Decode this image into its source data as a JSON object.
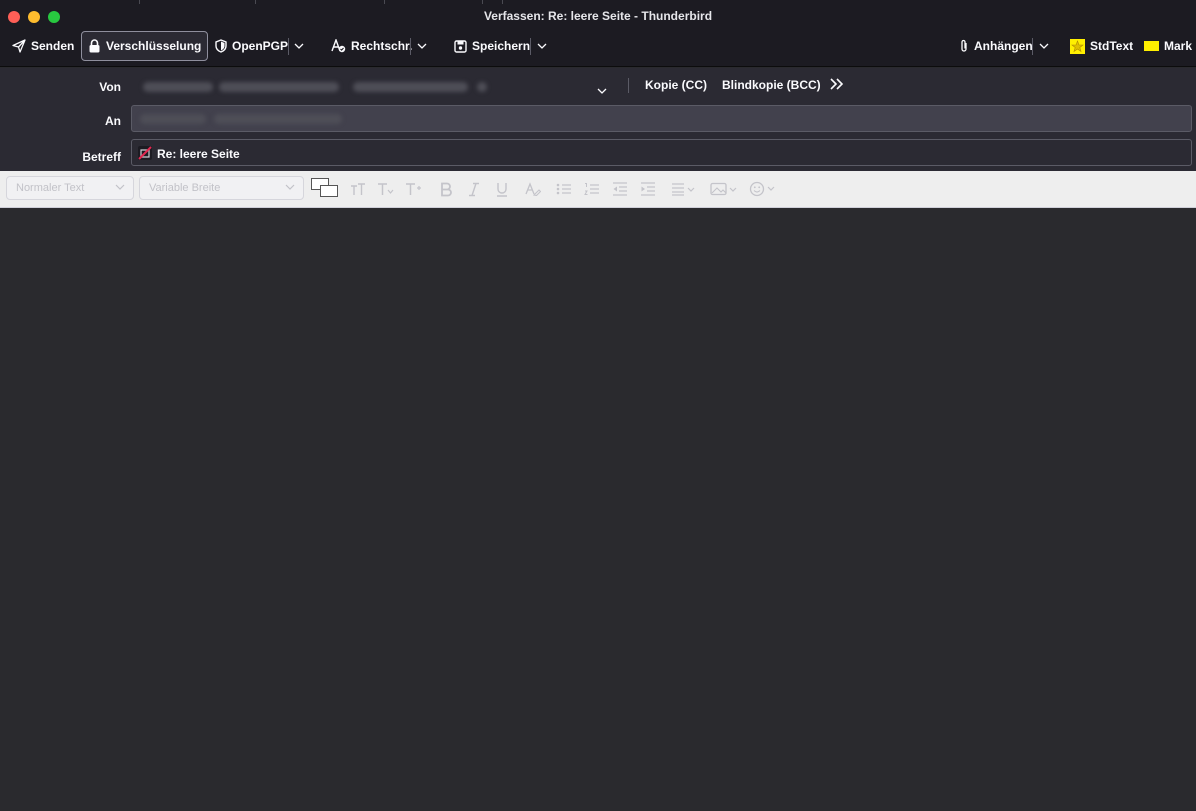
{
  "window": {
    "title": "Verfassen: Re: leere Seite - Thunderbird"
  },
  "toolbar": {
    "send_label": "Senden",
    "encryption_label": "Verschlüsselung",
    "openpgp_label": "OpenPGP",
    "spellcheck_label": "Rechtschr.",
    "save_label": "Speichern",
    "attach_label": "Anhängen",
    "stdtext_label": "StdText",
    "mark_label": "Mark"
  },
  "header": {
    "from_label": "Von",
    "to_label": "An",
    "subject_label": "Betreff",
    "cc_label": "Kopie (CC)",
    "bcc_label": "Blindkopie (BCC)",
    "subject_value": "Re: leere Seite"
  },
  "formatbar": {
    "paragraph_format": "Normaler Text",
    "font_family": "Variable Breite"
  },
  "colors": {
    "accent_yellow": "#ffef00",
    "toolbar_bg": "#1c1b22",
    "editor_bg": "#2a2a2e"
  }
}
